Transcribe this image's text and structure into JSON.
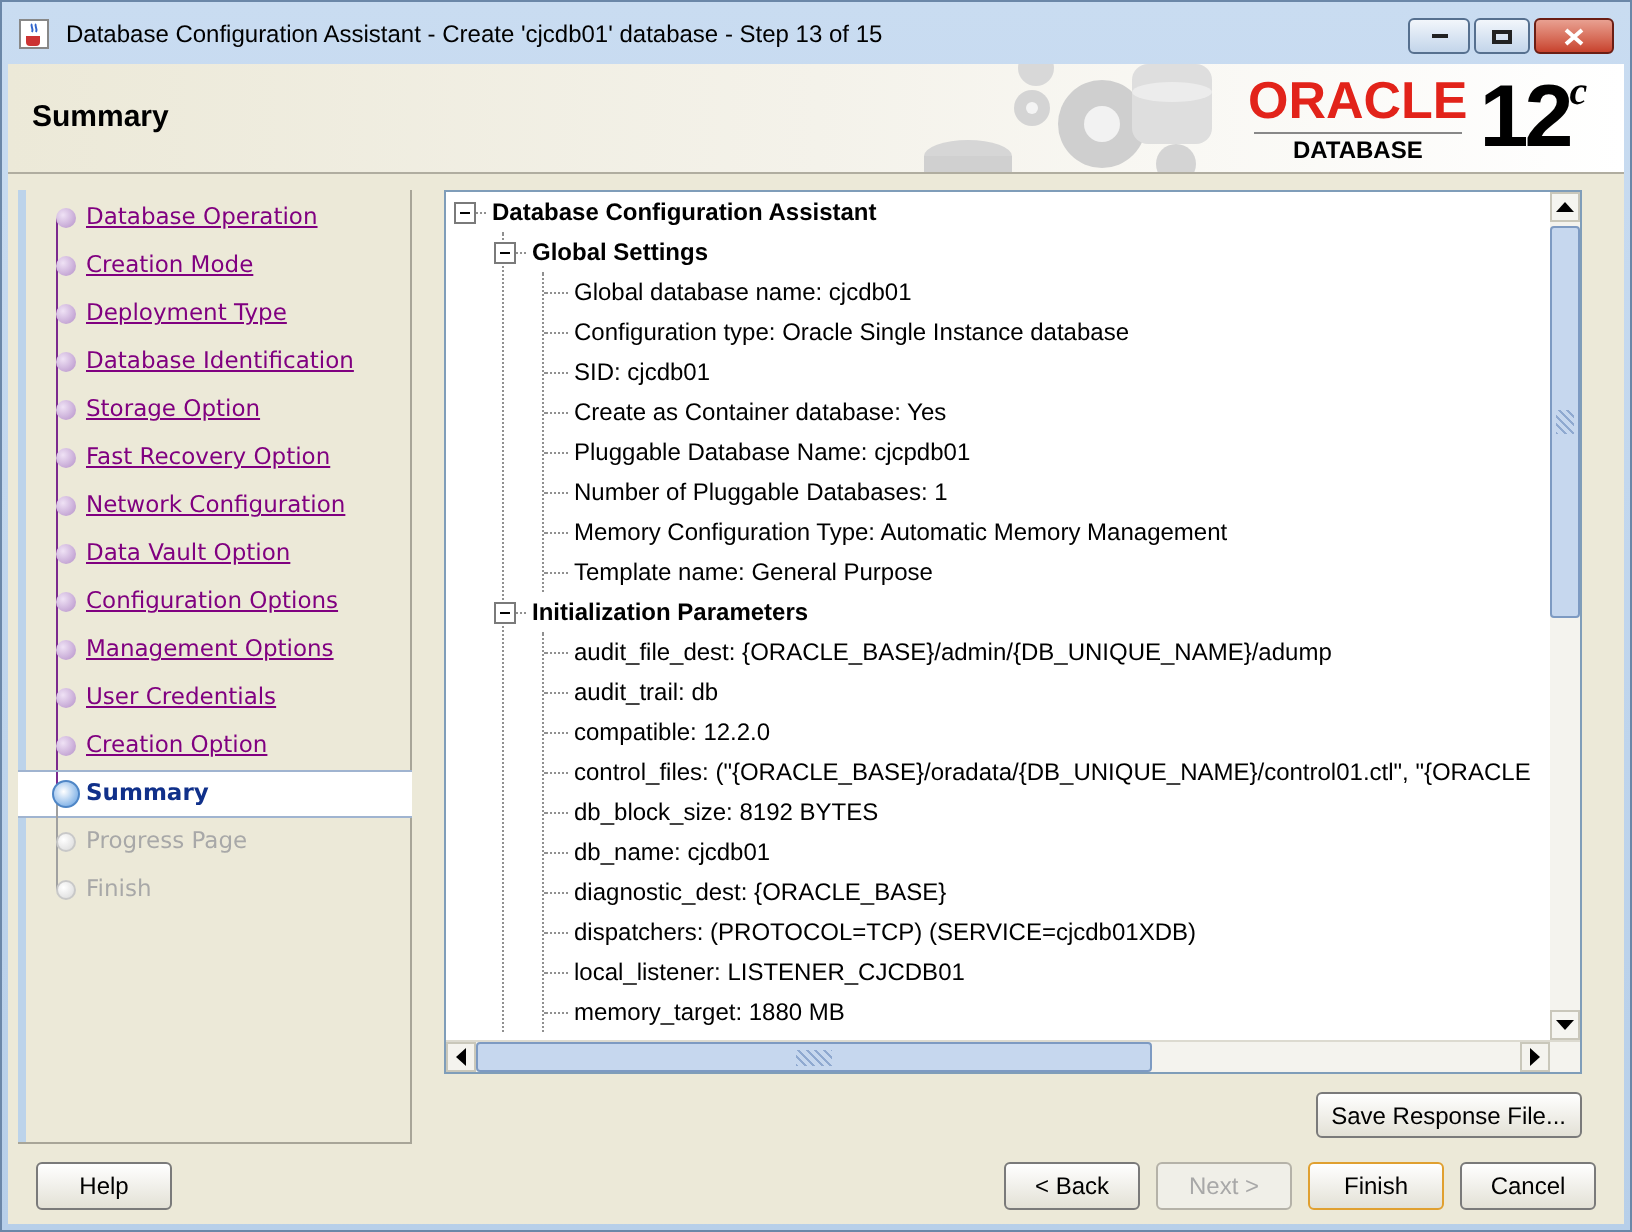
{
  "window": {
    "title": "Database Configuration Assistant - Create 'cjcdb01' database - Step 13 of 15"
  },
  "header": {
    "title": "Summary",
    "logo": {
      "brand": "ORACLE",
      "product": "DATABASE",
      "version": "12",
      "edition": "c"
    }
  },
  "steps": [
    {
      "label": "Database Operation",
      "kind": "visited",
      "selected": false
    },
    {
      "label": "Creation Mode",
      "kind": "visited",
      "selected": false
    },
    {
      "label": "Deployment Type",
      "kind": "visited",
      "selected": false
    },
    {
      "label": "Database Identification",
      "kind": "visited",
      "selected": false
    },
    {
      "label": "Storage Option",
      "kind": "visited",
      "selected": false
    },
    {
      "label": "Fast Recovery Option",
      "kind": "visited",
      "selected": false
    },
    {
      "label": "Network Configuration",
      "kind": "visited",
      "selected": false
    },
    {
      "label": "Data Vault Option",
      "kind": "visited",
      "selected": false
    },
    {
      "label": "Configuration Options",
      "kind": "visited",
      "selected": false
    },
    {
      "label": "Management Options",
      "kind": "visited",
      "selected": false
    },
    {
      "label": "User Credentials",
      "kind": "visited",
      "selected": false
    },
    {
      "label": "Creation Option",
      "kind": "visited",
      "selected": false
    },
    {
      "label": "Summary",
      "kind": "current",
      "selected": true
    },
    {
      "label": "Progress Page",
      "kind": "pending",
      "selected": false
    },
    {
      "label": "Finish",
      "kind": "pending",
      "selected": false
    }
  ],
  "summary_tree": [
    {
      "label": "Database Configuration Assistant",
      "expanded": true,
      "children": [
        {
          "label": "Global Settings",
          "expanded": true,
          "children": [
            {
              "label": "Global database name: cjcdb01"
            },
            {
              "label": "Configuration type: Oracle Single Instance database"
            },
            {
              "label": "SID: cjcdb01"
            },
            {
              "label": "Create as Container database: Yes"
            },
            {
              "label": "Pluggable Database Name: cjcpdb01"
            },
            {
              "label": "Number of Pluggable Databases: 1"
            },
            {
              "label": "Memory Configuration Type: Automatic Memory Management"
            },
            {
              "label": "Template name: General Purpose"
            }
          ]
        },
        {
          "label": "Initialization Parameters",
          "expanded": true,
          "children": [
            {
              "label": "audit_file_dest: {ORACLE_BASE}/admin/{DB_UNIQUE_NAME}/adump"
            },
            {
              "label": "audit_trail: db"
            },
            {
              "label": "compatible: 12.2.0"
            },
            {
              "label": "control_files: (\"{ORACLE_BASE}/oradata/{DB_UNIQUE_NAME}/control01.ctl\", \"{ORACLE"
            },
            {
              "label": "db_block_size: 8192 BYTES"
            },
            {
              "label": "db_name: cjcdb01"
            },
            {
              "label": "diagnostic_dest: {ORACLE_BASE}"
            },
            {
              "label": "dispatchers: (PROTOCOL=TCP) (SERVICE=cjcdb01XDB)"
            },
            {
              "label": "local_listener: LISTENER_CJCDB01"
            },
            {
              "label": "memory_target: 1880 MB"
            }
          ]
        }
      ]
    }
  ],
  "save_button": {
    "label": "Save Response File..."
  },
  "buttons": [
    {
      "label": "Help",
      "disabled": false,
      "default": false
    },
    {
      "label": "< Back",
      "disabled": false,
      "default": false
    },
    {
      "label": "Next >",
      "disabled": true,
      "default": false
    },
    {
      "label": "Finish",
      "disabled": false,
      "default": true
    },
    {
      "label": "Cancel",
      "disabled": false,
      "default": false
    }
  ]
}
